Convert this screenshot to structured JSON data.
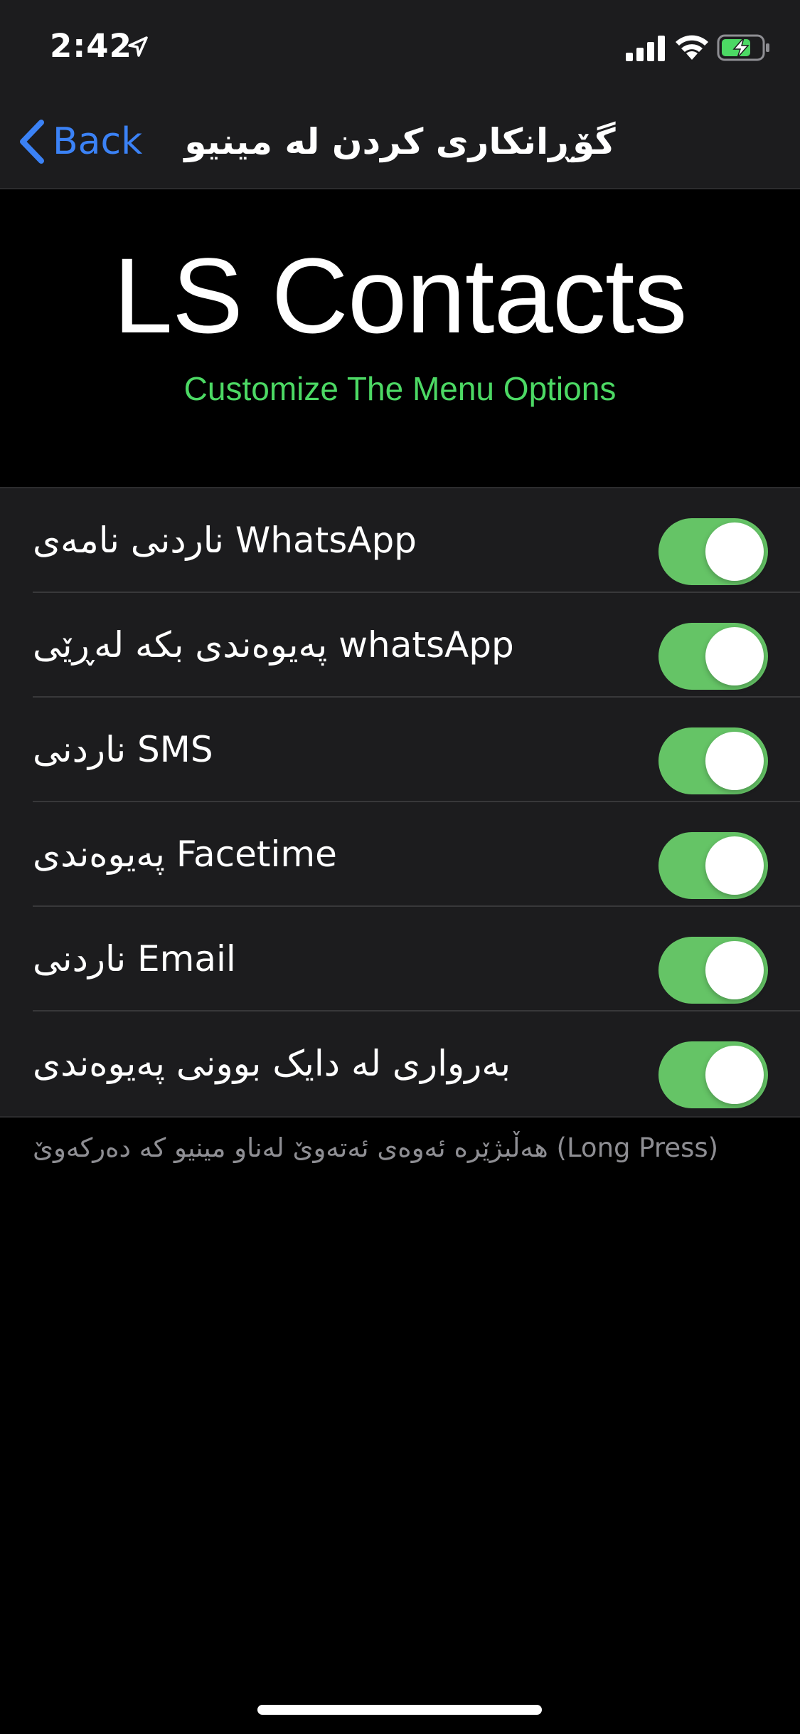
{
  "status_bar": {
    "time": "2:42",
    "icons": [
      "location-arrow-icon",
      "cellular-signal-icon",
      "wifi-icon",
      "battery-charging-icon"
    ]
  },
  "nav": {
    "back_label": "Back",
    "title": "گۆڕانکاری کردن لە مینیو"
  },
  "header": {
    "title": "LS Contacts",
    "subtitle": "Customize The Menu Options"
  },
  "settings": [
    {
      "label": "ناردنی نامەی WhatsApp",
      "enabled": true
    },
    {
      "label": "پەیوەندی بکە لەڕێی whatsApp",
      "enabled": true
    },
    {
      "label": "ناردنی SMS",
      "enabled": true
    },
    {
      "label": "پەیوەندی Facetime",
      "enabled": true
    },
    {
      "label": "ناردنی Email",
      "enabled": true
    },
    {
      "label": "بەرواری لە دایک بوونی پەیوەندی",
      "enabled": true
    }
  ],
  "footer_note": "هەڵبژێرە ئەوەی ئەتەوێ لەناو مینیو کە دەرکەوێ (Long Press)",
  "colors": {
    "accent_blue": "#3b82f6",
    "subtitle_green": "#4cd964",
    "toggle_on": "#65c466",
    "cell_background": "#1c1c1e"
  }
}
